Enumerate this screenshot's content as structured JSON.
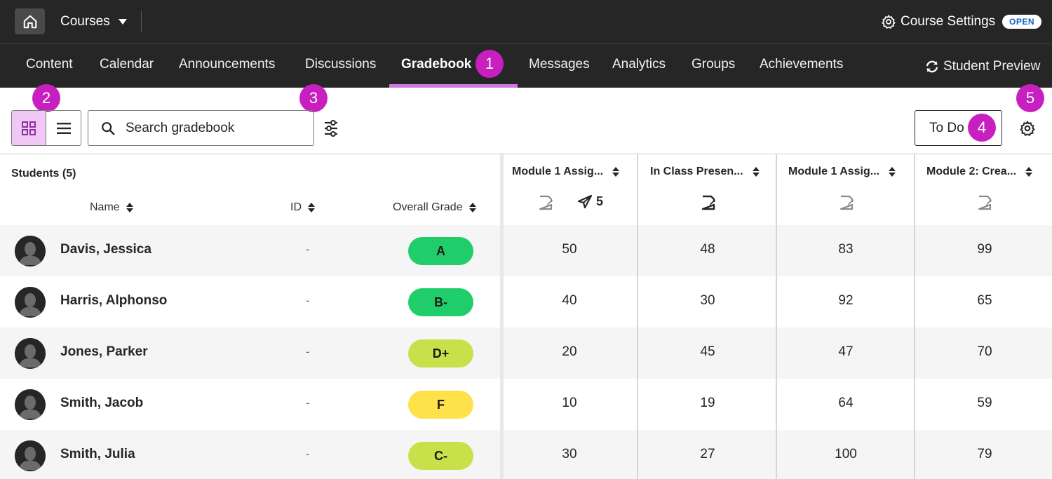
{
  "topbar": {
    "courses_label": "Courses",
    "course_settings_label": "Course Settings",
    "open_badge": "OPEN"
  },
  "nav": {
    "items": [
      {
        "label": "Content"
      },
      {
        "label": "Calendar"
      },
      {
        "label": "Announcements"
      },
      {
        "label": "Discussions"
      },
      {
        "label": "Gradebook",
        "active": true
      },
      {
        "label": "Messages"
      },
      {
        "label": "Analytics"
      },
      {
        "label": "Groups"
      },
      {
        "label": "Achievements"
      }
    ],
    "student_preview_label": "Student Preview"
  },
  "callouts": [
    "1",
    "2",
    "3",
    "4",
    "5"
  ],
  "toolbar": {
    "search_placeholder": "Search gradebook",
    "todo_label": "To Do"
  },
  "table": {
    "students_label": "Students (5)",
    "columns": {
      "name": "Name",
      "id": "ID",
      "overall": "Overall Grade"
    },
    "assignments": [
      {
        "title": "Module 1 Assig...",
        "sent_count": "5"
      },
      {
        "title": "In Class Presen..."
      },
      {
        "title": "Module 1 Assig..."
      },
      {
        "title": "Module 2: Crea..."
      }
    ],
    "rows": [
      {
        "name": "Davis, Jessica",
        "id": "-",
        "grade": "A",
        "grade_color": "#1fce6a",
        "scores": [
          "50",
          "48",
          "83",
          "99"
        ]
      },
      {
        "name": "Harris, Alphonso",
        "id": "-",
        "grade": "B-",
        "grade_color": "#1fce6a",
        "scores": [
          "40",
          "30",
          "92",
          "65"
        ]
      },
      {
        "name": "Jones, Parker",
        "id": "-",
        "grade": "D+",
        "grade_color": "#c8e04a",
        "scores": [
          "20",
          "45",
          "47",
          "70"
        ]
      },
      {
        "name": "Smith, Jacob",
        "id": "-",
        "grade": "F",
        "grade_color": "#ffe24a",
        "scores": [
          "10",
          "19",
          "64",
          "59"
        ]
      },
      {
        "name": "Smith, Julia",
        "id": "-",
        "grade": "C-",
        "grade_color": "#c8e04a",
        "scores": [
          "30",
          "27",
          "100",
          "79"
        ]
      }
    ]
  },
  "colors": {
    "accent": "#cc7adb",
    "callout": "#c820c0",
    "dark_bar": "#262626"
  }
}
